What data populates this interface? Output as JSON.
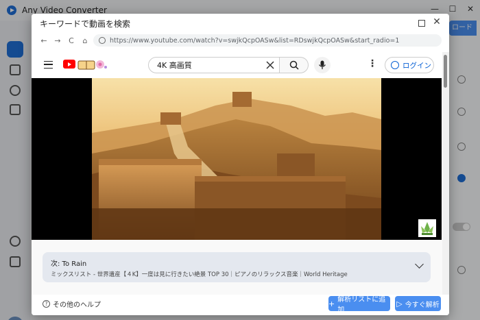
{
  "app": {
    "title": "Any Video Converter",
    "right_button_label": "ロード"
  },
  "dialog": {
    "title": "キーワードで動画を検索",
    "url": "https://www.youtube.com/watch?v=swjkQcpOASw&list=RDswjkQcpOASw&start_radio=1",
    "nav": {
      "back": "←",
      "forward": "→",
      "reload": "C",
      "home": "⌂"
    },
    "close_icon": "✕"
  },
  "youtube": {
    "search_value": "4K 高画質",
    "login_label": "ログイン",
    "more_icon": "⋮",
    "next_title": "次: To Rain",
    "next_subtitle": "ミックスリスト - 世界遺産【４K】一度は見に行きたい絶景 TOP 30｜ピアノのリラックス音楽｜World Heritage"
  },
  "footer": {
    "help_label": "その他のヘルプ",
    "add_label": "解析リストに追加",
    "parse_label": "今すぐ解析"
  },
  "colors": {
    "accent": "#4a8ef0",
    "youtube_red": "#ff0000"
  }
}
